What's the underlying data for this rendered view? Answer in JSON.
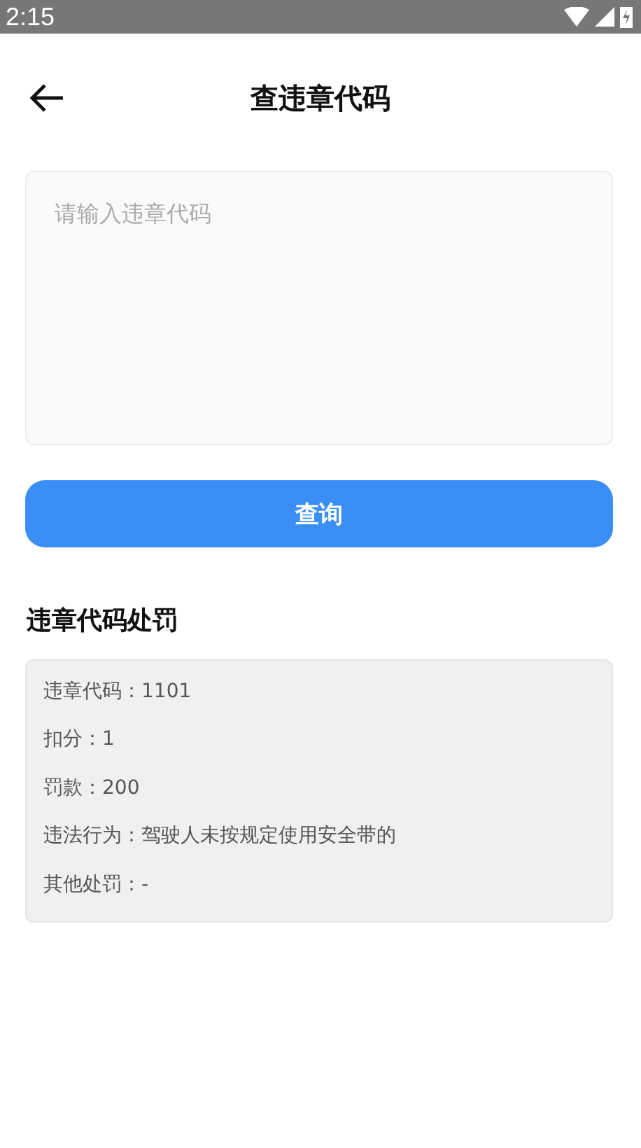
{
  "status_bar": {
    "time": "2:15"
  },
  "header": {
    "title": "查违章代码"
  },
  "code_field": {
    "placeholder": "请输入违章代码"
  },
  "query_button": {
    "label": "查询"
  },
  "result": {
    "title": "违章代码处罚",
    "lines": [
      "违章代码：1101",
      "扣分：1",
      "罚款：200",
      "违法行为：驾驶人未按规定使用安全带的",
      "其他处罚：-"
    ]
  }
}
